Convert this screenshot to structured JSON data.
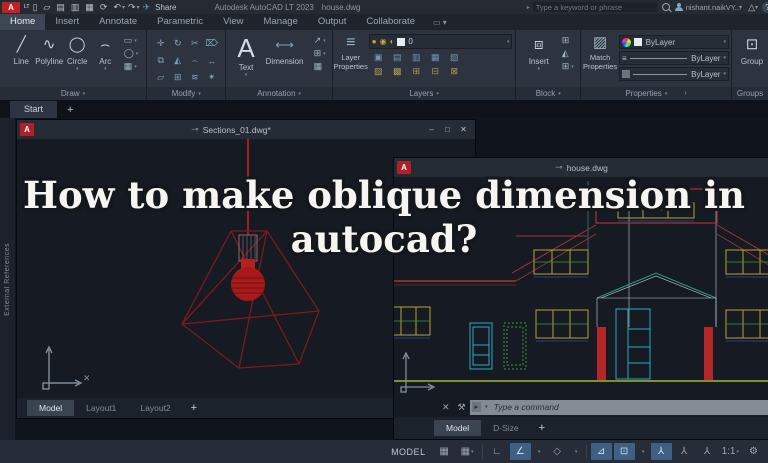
{
  "colors": {
    "accent_red": "#c22026",
    "cad_red": "#a83434",
    "cad_yellow": "#b2a431",
    "cad_green": "#3a9a3a",
    "cad_cyan": "#2fa8c0",
    "cad_blue": "#3546a8",
    "active_blue": "#3f5f85"
  },
  "titlebar": {
    "logo": "A",
    "logo_badge": "LT",
    "share_label": "Share",
    "app_title": "Autodesk AutoCAD LT 2023",
    "doc_name": "house.dwg",
    "search_placeholder": "Type a keyword or phrase",
    "user_name": "nishant.naikVY...",
    "help": "?"
  },
  "ribbon": {
    "tabs": [
      {
        "label": "Home"
      },
      {
        "label": "Insert"
      },
      {
        "label": "Annotate"
      },
      {
        "label": "Parametric"
      },
      {
        "label": "View"
      },
      {
        "label": "Manage"
      },
      {
        "label": "Output"
      },
      {
        "label": "Collaborate"
      }
    ],
    "draw": {
      "label": "Draw",
      "line": "Line",
      "polyline": "Polyline",
      "circle": "Circle",
      "arc": "Arc"
    },
    "modify": {
      "label": "Modify"
    },
    "annotation": {
      "label": "Annotation",
      "text": "Text",
      "dimension": "Dimension"
    },
    "layers": {
      "label": "Layers",
      "layer_properties": "Layer Properties",
      "current_layer": "0"
    },
    "block": {
      "label": "Block",
      "insert": "Insert"
    },
    "properties": {
      "label": "Properties",
      "match": "Match Properties",
      "color_value": "ByLayer",
      "lineweight_value": "ByLayer",
      "linetype_value": "ByLayer"
    },
    "groups": {
      "label": "Groups",
      "group": "Group"
    }
  },
  "file_tabs": {
    "start": "Start",
    "add": "+"
  },
  "overlay": {
    "line1": "How to make oblique dimension in",
    "line2": "autocad?"
  },
  "left_window": {
    "title": "Sections_01.dwg*",
    "palette_label": "External References",
    "tabs": [
      {
        "label": "Model"
      },
      {
        "label": "Layout1"
      },
      {
        "label": "Layout2"
      }
    ],
    "add_tab": "+"
  },
  "right_window": {
    "title": "house.dwg",
    "command_placeholder": "Type a command",
    "tabs": [
      {
        "label": "Model"
      },
      {
        "label": "D-Size"
      }
    ],
    "add_tab": "+"
  },
  "status_bar": {
    "model": "MODEL",
    "scale": "1:1"
  },
  "icons": {
    "qa_new": "▯",
    "qa_open": "▱",
    "qa_save": "▤",
    "qa_saveas": "▥",
    "qa_plot": "▦",
    "qa_sync": "⟳",
    "qa_undo": "↶",
    "qa_redo": "↷",
    "qa_share": "✈",
    "autodesk": "△",
    "draw_line": "╱",
    "draw_polyline": "∿",
    "draw_circle": "◯",
    "draw_arc": "⌢",
    "draw_rect": "▭",
    "draw_ellipse": "◯",
    "draw_hatch": "▦",
    "mod": [
      "✛",
      "↻",
      "✂",
      "⌦",
      "⧉",
      "◭",
      "⌢",
      "↔",
      "▱",
      "⊞",
      "≋",
      "✴"
    ],
    "annot_text": "A",
    "annot_dim": "⟷",
    "annot_leader": "↗",
    "annot_table": "▦",
    "annot_style": "⊞",
    "layers_big": "≡",
    "bulb": "●",
    "sun": "◉",
    "lock": "◐",
    "lyr_row1": [
      "▣",
      "▤",
      "▥",
      "▦",
      "▧"
    ],
    "lyr_row2": [
      "▨",
      "▩",
      "⊞",
      "⊟",
      "⊠"
    ],
    "block_insert": "⧈",
    "prop_match": "▨",
    "group": "⊡",
    "pin": "⊸",
    "min": "–",
    "max": "□",
    "close": "✕",
    "cmd_close": "✕",
    "cmd_wrench": "⚒",
    "cmd_prompt": "▸",
    "sb_grid": "▦",
    "sb_ortho": "∟",
    "sb_polar": "∠",
    "sb_iso": "◇",
    "sb_track": "⊿",
    "sb_osnap": "⊡",
    "sb_annot": "⅄",
    "sb_gear": "⚙",
    "caret": "▾"
  }
}
